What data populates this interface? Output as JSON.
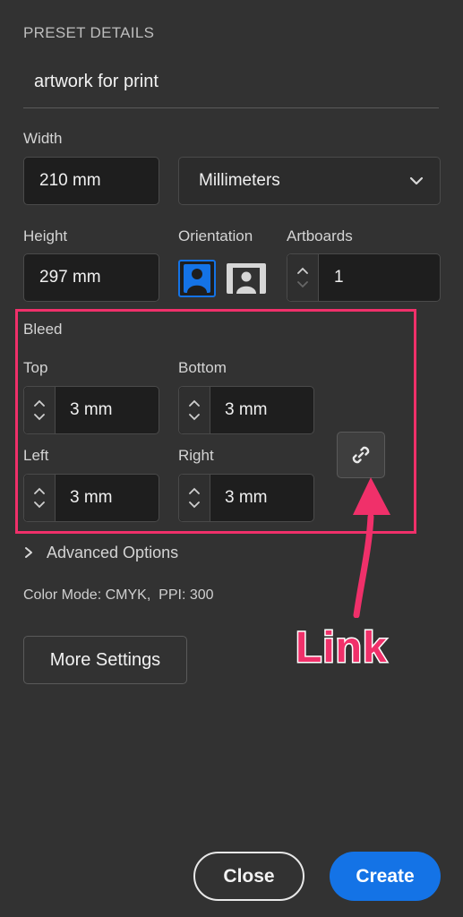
{
  "preset": {
    "section_title": "PRESET DETAILS",
    "name_value": "artwork for print"
  },
  "width": {
    "label": "Width",
    "value": "210 mm"
  },
  "units": {
    "selected": "Millimeters"
  },
  "height": {
    "label": "Height",
    "value": "297 mm"
  },
  "orientation": {
    "label": "Orientation",
    "selected": "portrait"
  },
  "artboards": {
    "label": "Artboards",
    "value": "1"
  },
  "bleed": {
    "title": "Bleed",
    "top": {
      "label": "Top",
      "value": "3 mm"
    },
    "bottom": {
      "label": "Bottom",
      "value": "3 mm"
    },
    "left": {
      "label": "Left",
      "value": "3 mm"
    },
    "right": {
      "label": "Right",
      "value": "3 mm"
    }
  },
  "advanced": {
    "label": "Advanced Options"
  },
  "color_info": "Color Mode: CMYK,  PPI: 300",
  "more_settings_label": "More Settings",
  "annotation": {
    "text": "Link",
    "color": "#f0306a"
  },
  "footer": {
    "close_label": "Close",
    "create_label": "Create"
  },
  "colors": {
    "background": "#323232",
    "field": "#1e1e1e",
    "accent_blue": "#1473e6",
    "highlight_pink": "#f0306a"
  },
  "icons": {
    "portrait": "portrait-icon",
    "landscape": "landscape-icon",
    "link": "link-icon",
    "chevron_right": "chevron-right-icon",
    "chevron_down": "chevron-down-icon"
  }
}
